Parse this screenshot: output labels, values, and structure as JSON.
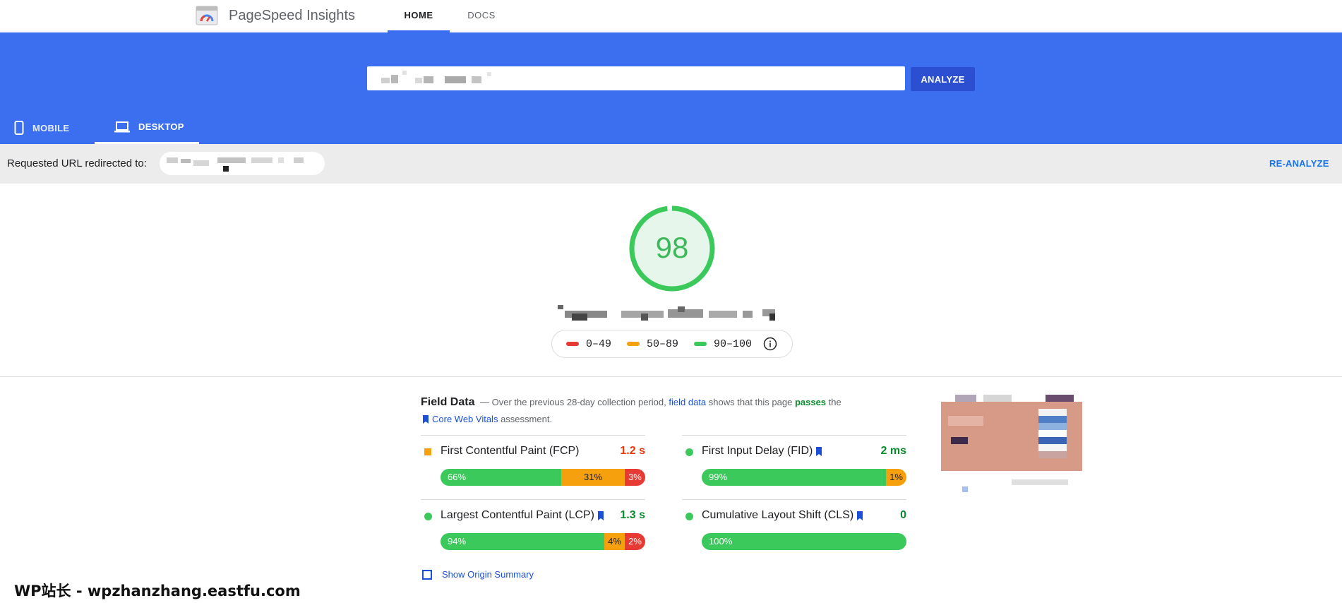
{
  "header": {
    "brand": "PageSpeed Insights",
    "tabs": [
      {
        "label": "HOME",
        "active": true
      },
      {
        "label": "DOCS",
        "active": false
      }
    ]
  },
  "search": {
    "url_value": "",
    "analyze_label": "ANALYZE"
  },
  "device_tabs": [
    {
      "label": "MOBILE",
      "active": false
    },
    {
      "label": "DESKTOP",
      "active": true
    }
  ],
  "redirect": {
    "label": "Requested URL redirected to:",
    "reanalyze_label": "RE-ANALYZE"
  },
  "score": {
    "value": "98",
    "fraction": 0.98,
    "color": "#0cce6b",
    "legend": [
      {
        "range": "0–49",
        "color": "#e83a34"
      },
      {
        "range": "50–89",
        "color": "#f5a00c"
      },
      {
        "range": "90–100",
        "color": "#3cc95b"
      }
    ]
  },
  "field_data": {
    "title": "Field Data",
    "desc_dash": "—",
    "desc_pre": "Over the previous 28-day collection period,",
    "desc_link": "field data",
    "desc_mid": "shows that this page",
    "desc_pass": "passes",
    "desc_post": "the",
    "cwv_link": "Core Web Vitals",
    "cwv_post": "assessment.",
    "metrics": [
      {
        "label": "First Contentful Paint (FCP)",
        "value": "1.2 s",
        "value_color": "#e8380c",
        "indicator": "orange-square",
        "cwv": false,
        "segments": [
          {
            "pct": 66,
            "label": "66%"
          },
          {
            "pct": 31,
            "label": "31%"
          },
          {
            "pct": 3,
            "label": "3%"
          }
        ]
      },
      {
        "label": "First Input Delay (FID)",
        "value": "2 ms",
        "value_color": "#0b8a2e",
        "indicator": "green-dot",
        "cwv": true,
        "segments": [
          {
            "pct": 99,
            "label": "99%"
          },
          {
            "pct": 1,
            "label": "1%"
          }
        ]
      },
      {
        "label": "Largest Contentful Paint (LCP)",
        "value": "1.3 s",
        "value_color": "#0b8a2e",
        "indicator": "green-dot",
        "cwv": true,
        "segments": [
          {
            "pct": 94,
            "label": "94%"
          },
          {
            "pct": 4,
            "label": "4%"
          },
          {
            "pct": 2,
            "label": "2%"
          }
        ]
      },
      {
        "label": "Cumulative Layout Shift (CLS)",
        "value": "0",
        "value_color": "#0b8a2e",
        "indicator": "green-dot",
        "cwv": true,
        "segments": [
          {
            "pct": 100,
            "label": "100%"
          }
        ]
      }
    ],
    "show_origin_label": "Show Origin Summary"
  },
  "watermark": "WP站长 - wpzhanzhang.eastfu.com"
}
